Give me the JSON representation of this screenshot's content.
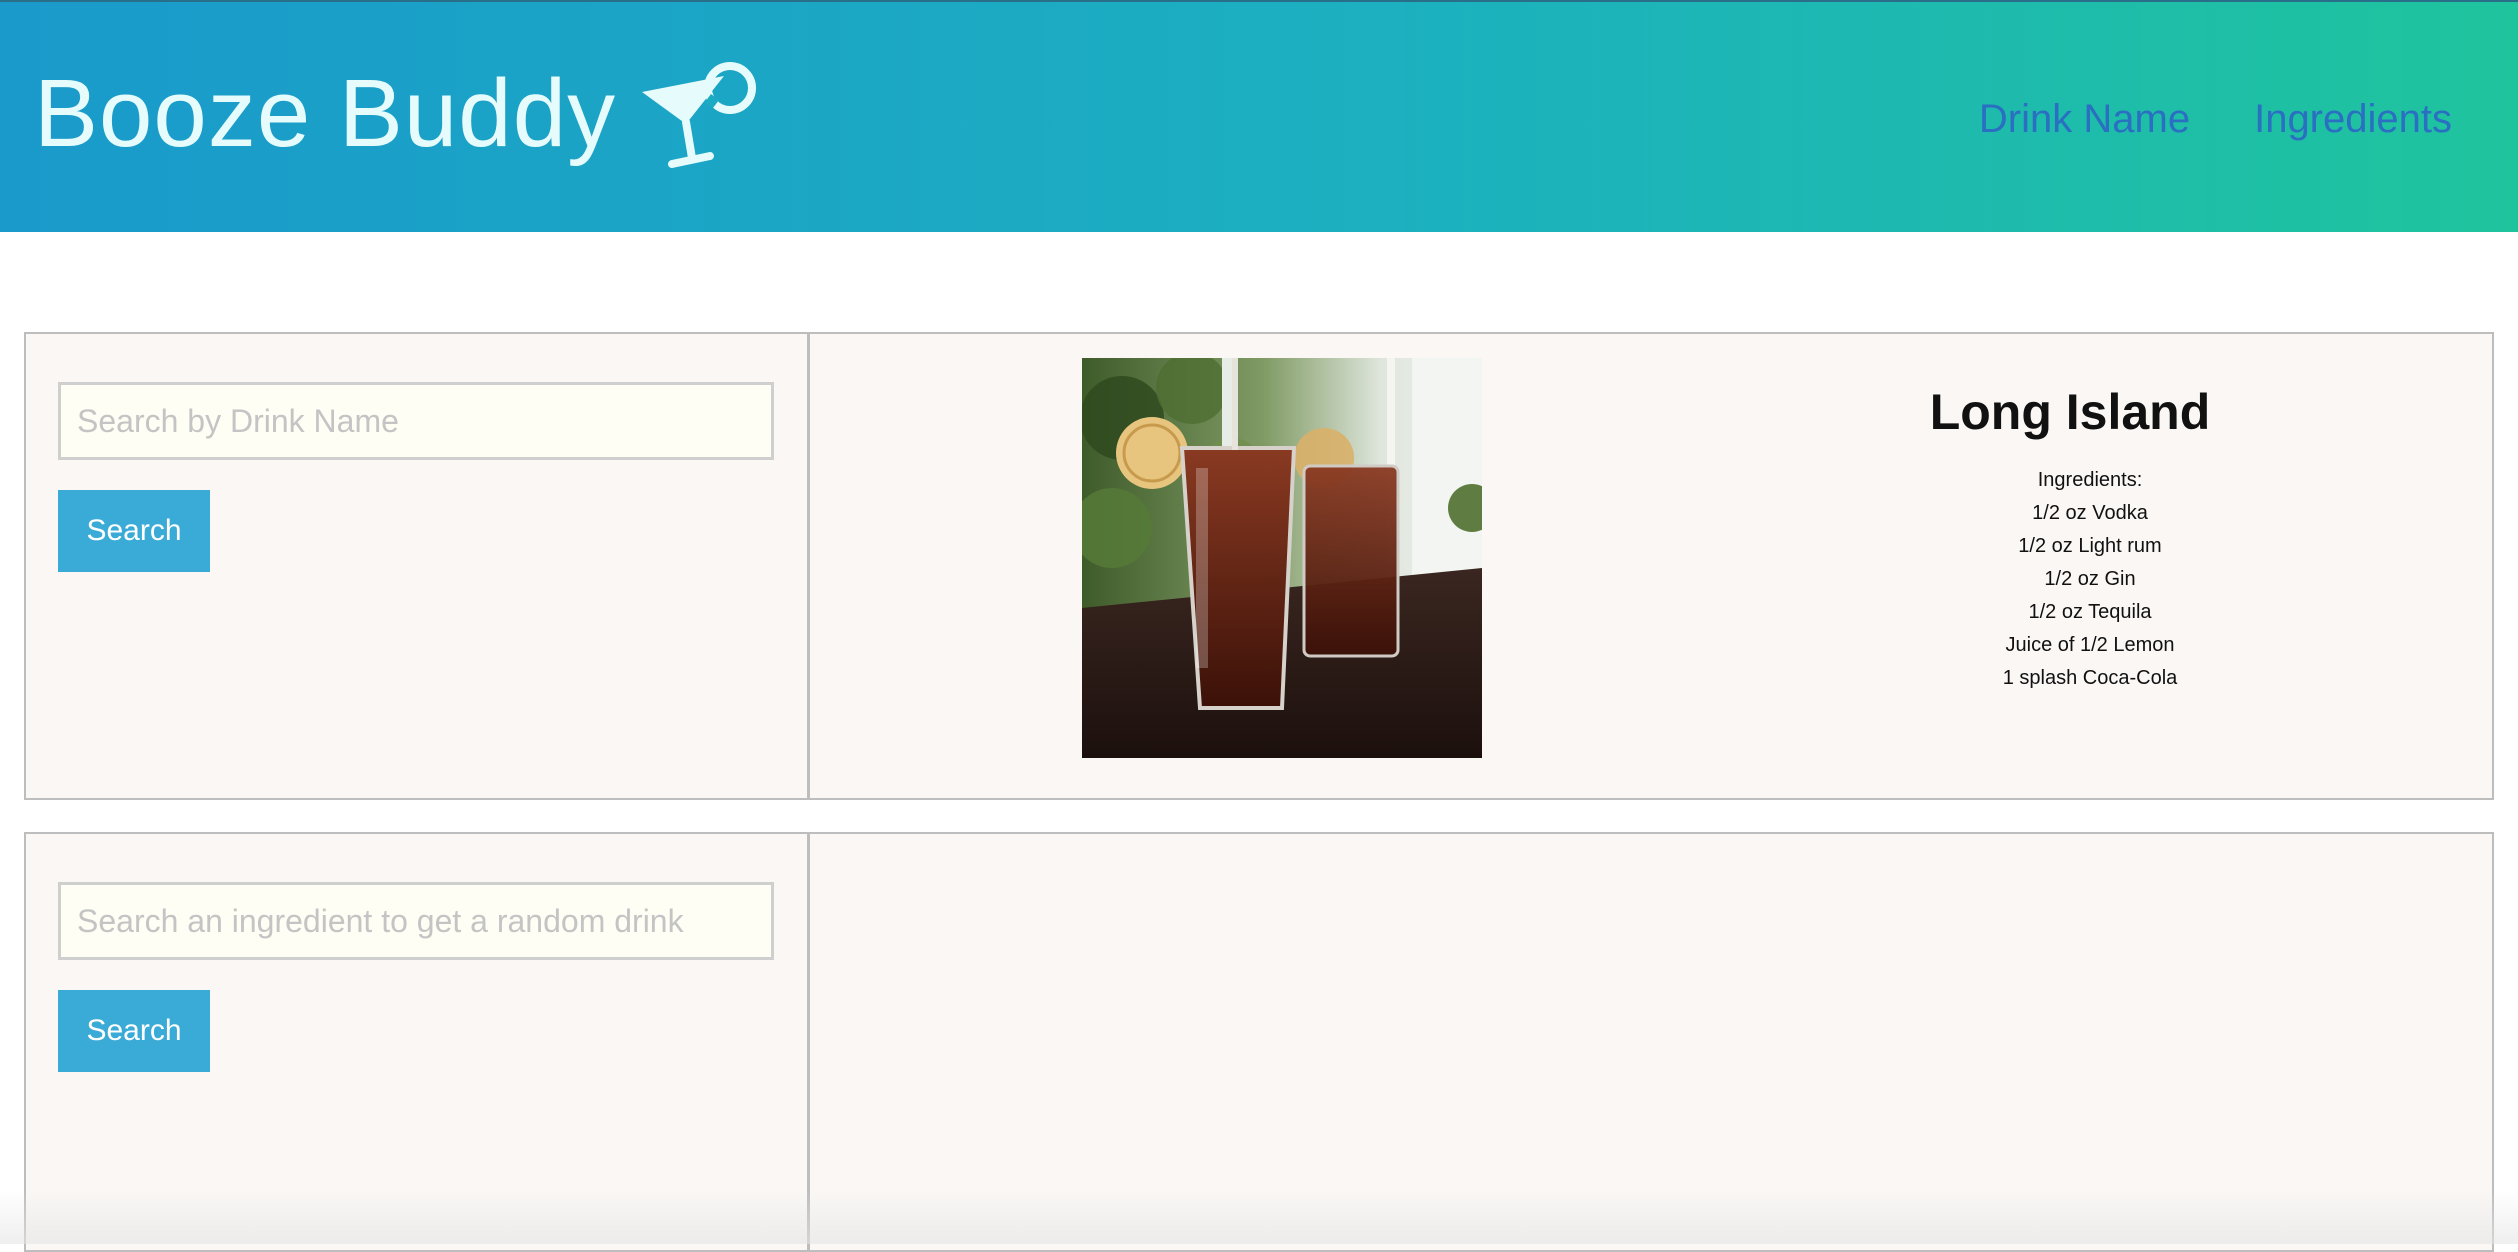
{
  "header": {
    "title": "Booze Buddy",
    "icon": "cocktail-glass-icon",
    "nav": [
      {
        "label": "Drink Name"
      },
      {
        "label": "Ingredients"
      }
    ]
  },
  "name_search": {
    "placeholder": "Search by Drink Name",
    "value": "",
    "button_label": "Search"
  },
  "ingredient_search": {
    "placeholder": "Search an ingredient to get a random drink",
    "value": "",
    "button_label": "Search"
  },
  "drink": {
    "name": "Long Island",
    "ingredients_heading": "Ingredients:",
    "ingredients": [
      "1/2 oz Vodka",
      "1/2 oz Light rum",
      "1/2 oz Gin",
      "1/2 oz Tequila",
      "Juice of 1/2 Lemon",
      "1 splash Coca-Cola"
    ]
  },
  "colors": {
    "header_start": "#1a9acb",
    "header_end": "#1fc49d",
    "nav_link": "#2a6fc1",
    "button": "#3aabd6",
    "panel_bg": "#faf7f5"
  }
}
